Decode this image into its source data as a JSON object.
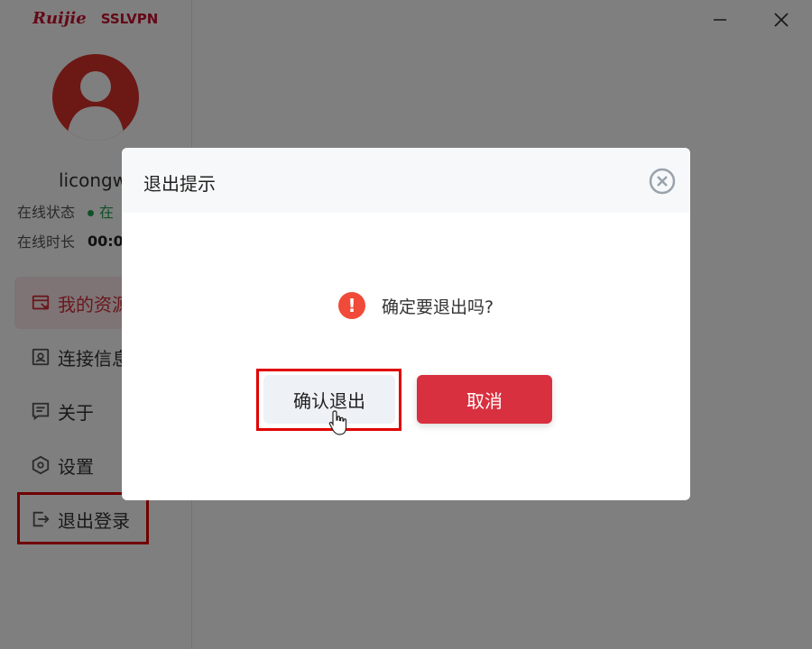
{
  "brand": {
    "logo": "Ruijie",
    "product": "SSLVPN"
  },
  "window": {
    "minimize_icon": "minimize-icon",
    "close_icon": "close-icon"
  },
  "user": {
    "name": "licongw",
    "status_label": "在线状态",
    "status_value": "在",
    "duration_label": "在线时长",
    "duration_value": "00:0"
  },
  "nav": {
    "items": [
      {
        "label": "我的资源",
        "icon": "resource-icon",
        "active": true
      },
      {
        "label": "连接信息",
        "icon": "connection-info-icon"
      },
      {
        "label": "关于",
        "icon": "about-icon"
      },
      {
        "label": "设置",
        "icon": "settings-icon"
      },
      {
        "label": "退出登录",
        "icon": "logout-icon"
      }
    ]
  },
  "dialog": {
    "title": "退出提示",
    "message": "确定要退出吗?",
    "confirm_label": "确认退出",
    "cancel_label": "取消"
  },
  "colors": {
    "brand": "#c8102e",
    "cancel": "#d9303f",
    "warning": "#f04a38",
    "online": "#1aa34a",
    "highlight": "#e00000"
  }
}
